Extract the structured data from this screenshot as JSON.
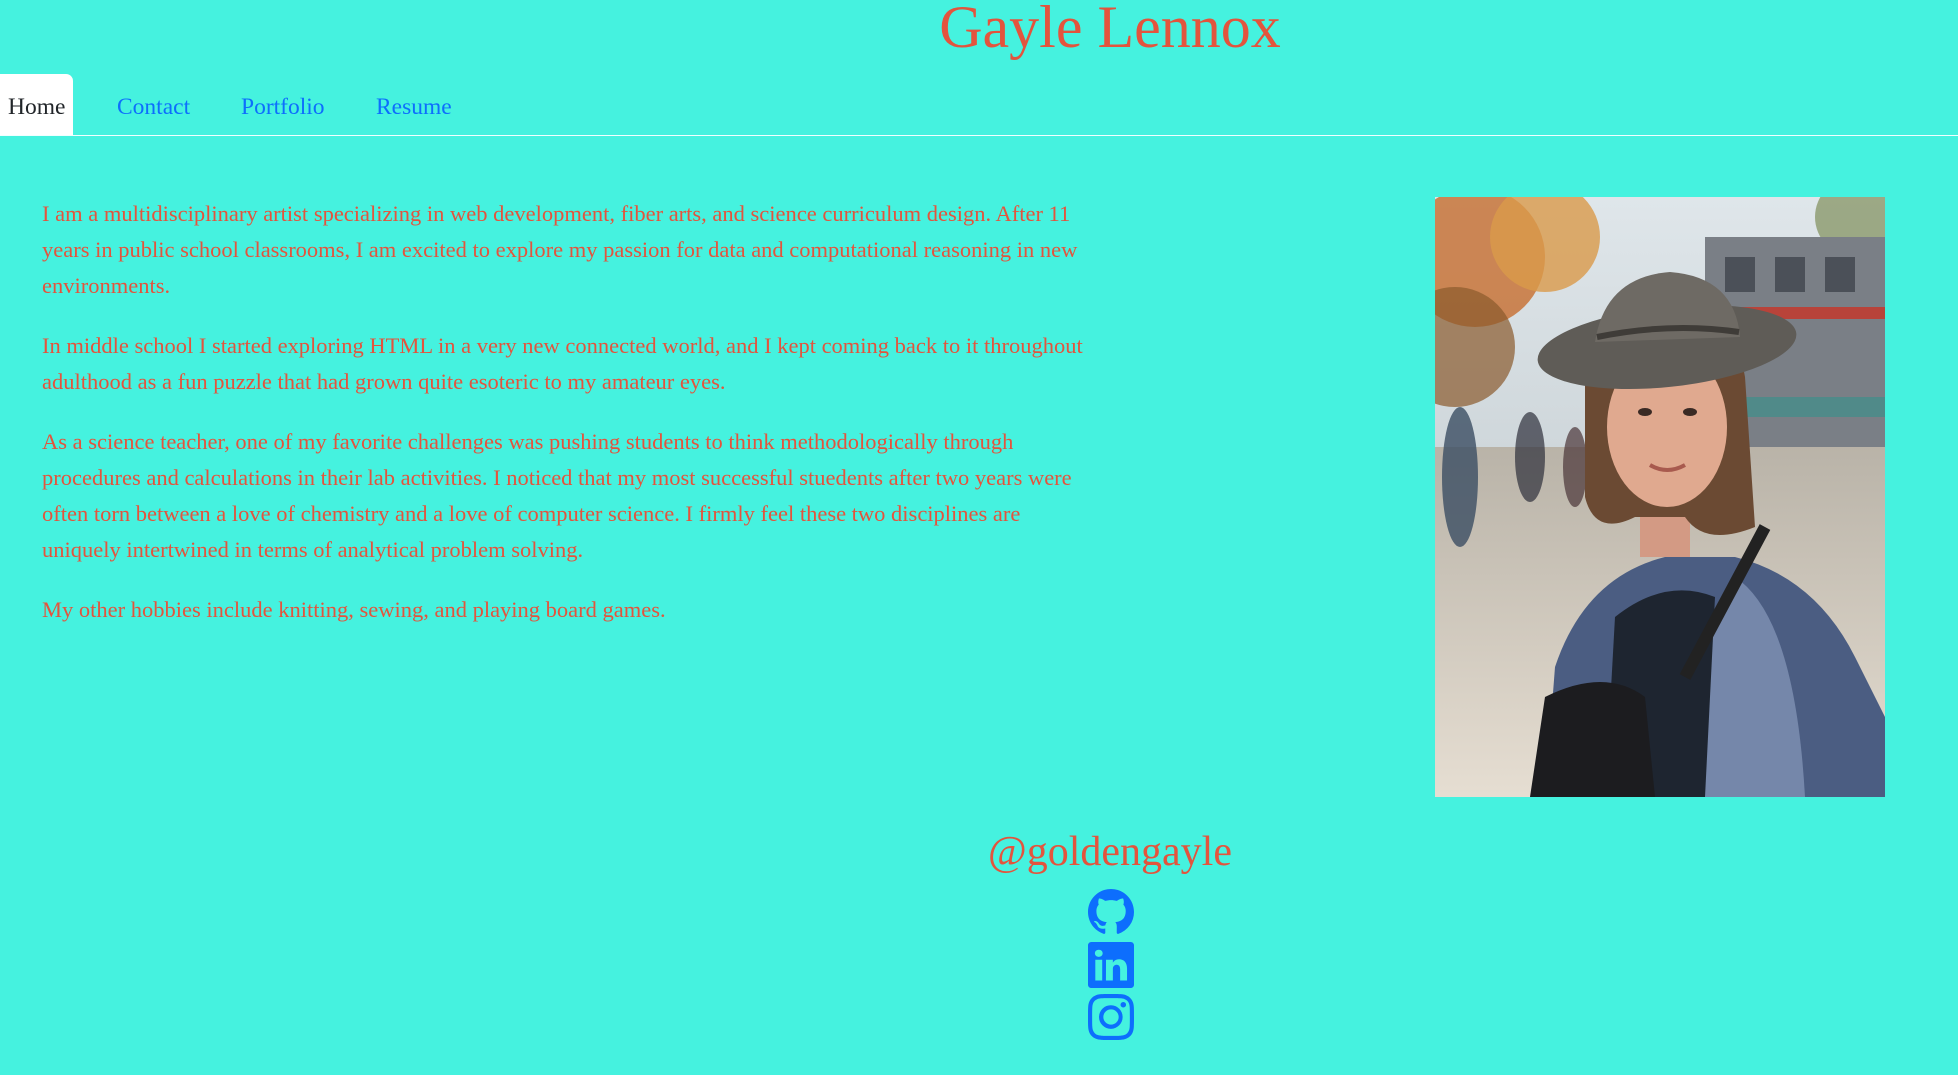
{
  "header": {
    "title": "Gayle Lennox"
  },
  "nav": {
    "items": [
      {
        "label": "Home",
        "active": true
      },
      {
        "label": "Contact",
        "active": false
      },
      {
        "label": "Portfolio",
        "active": false
      },
      {
        "label": "Resume",
        "active": false
      }
    ]
  },
  "bio": {
    "paragraphs": [
      "I am a multidisciplinary artist specializing in web development, fiber arts, and science curriculum design. After 11 years in public school classrooms, I am excited to explore my passion for data and computational reasoning in new environments.",
      "In middle school I started exploring HTML in a very new connected world, and I kept coming back to it throughout adulthood as a fun puzzle that had grown quite esoteric to my amateur eyes.",
      "As a science teacher, one of my favorite challenges was pushing students to think methodologically through procedures and calculations in their lab activities. I noticed that my most successful stuedents after two years were often torn between a love of chemistry and a love of computer science. I firmly feel these two disciplines are uniquely intertwined in terms of analytical problem solving.",
      "My other hobbies include knitting, sewing, and playing board games."
    ]
  },
  "photo": {
    "description": "portrait-photo"
  },
  "footer": {
    "handle": "@goldengayle",
    "social": [
      {
        "icon": "github-icon"
      },
      {
        "icon": "linkedin-icon"
      },
      {
        "icon": "instagram-icon"
      }
    ]
  },
  "colors": {
    "background": "#45f2df",
    "accent": "#e3543d",
    "link": "#0d6efd"
  }
}
